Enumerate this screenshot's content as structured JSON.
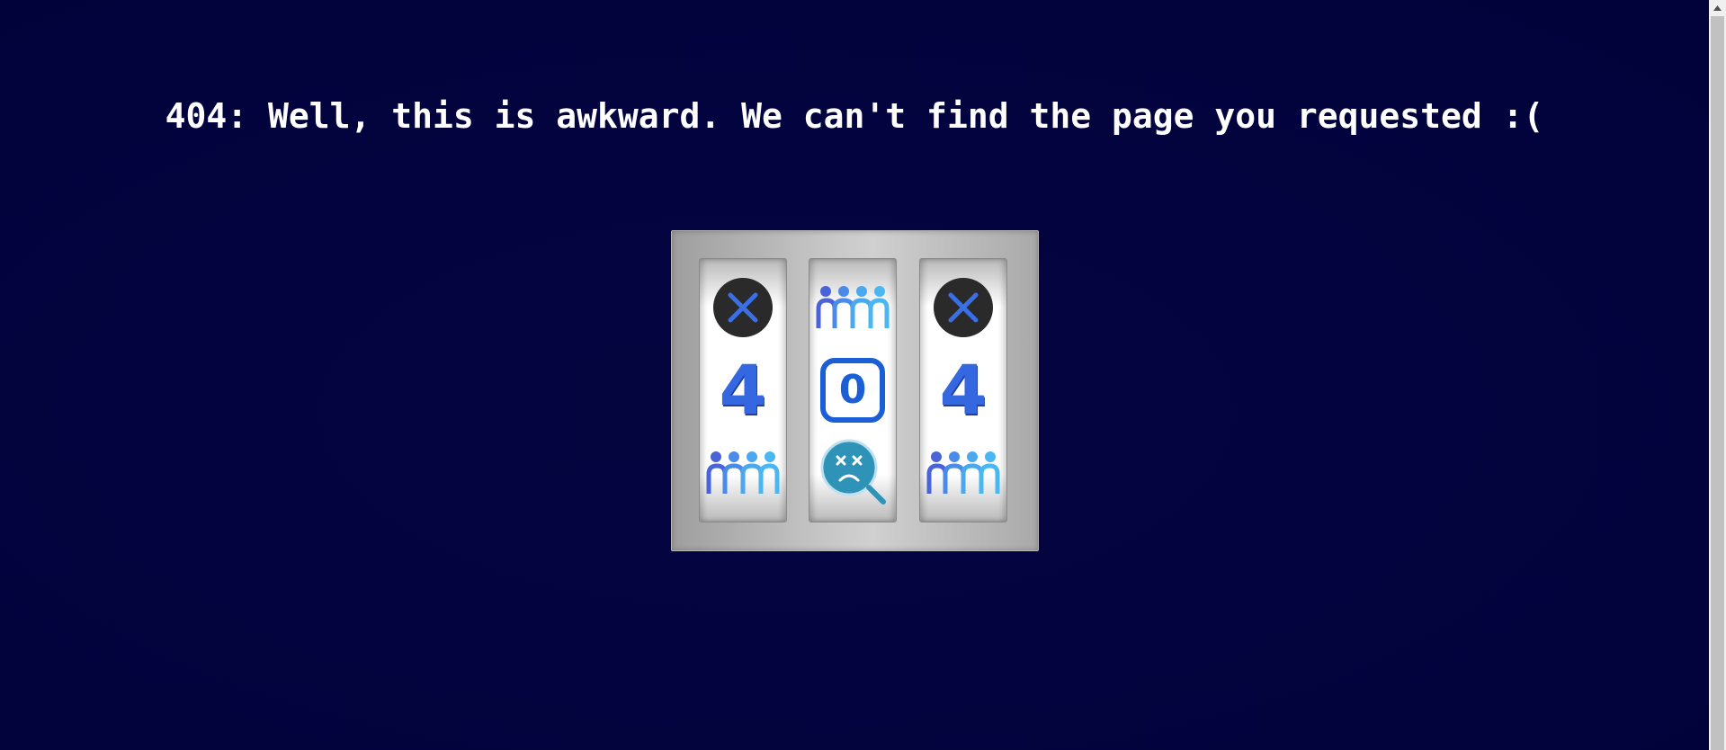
{
  "page": {
    "headline": "404: Well, this is awkward. We can't find the page you requested :("
  },
  "slot_machine": {
    "reels": [
      {
        "top": {
          "icon": "close-circle-icon"
        },
        "middle": {
          "icon": "number-four-icon",
          "text": "4"
        },
        "bottom": {
          "icon": "people-group-icon"
        }
      },
      {
        "top": {
          "icon": "people-group-icon"
        },
        "middle": {
          "icon": "keycap-zero-icon",
          "text": "0"
        },
        "bottom": {
          "icon": "sad-magnifier-icon"
        }
      },
      {
        "top": {
          "icon": "close-circle-icon"
        },
        "middle": {
          "icon": "number-four-icon",
          "text": "4"
        },
        "bottom": {
          "icon": "people-group-icon"
        }
      }
    ]
  },
  "colors": {
    "background": "#02023a",
    "headline": "#ffffff",
    "accent_blue": "#3568e0",
    "keycap_blue": "#1a5fd6",
    "magnifier_teal": "#2f93b8",
    "frame_gray": "#c6c6c6"
  }
}
